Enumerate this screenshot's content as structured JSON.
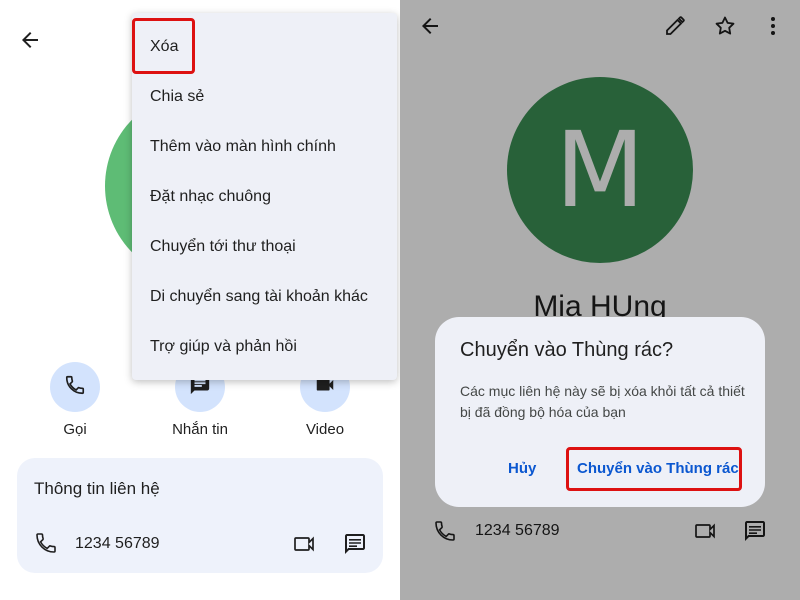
{
  "left": {
    "menu": {
      "items": [
        "Xóa",
        "Chia sẻ",
        "Thêm vào màn hình chính",
        "Đặt nhạc chuông",
        "Chuyển tới thư thoại",
        "Di chuyển sang tài khoản khác",
        "Trợ giúp và phản hồi"
      ]
    },
    "actions": {
      "call": "Gọi",
      "message": "Nhắn tin",
      "video": "Video"
    },
    "contact_info": {
      "title": "Thông tin liên hệ",
      "phone": "1234 56789"
    }
  },
  "right": {
    "avatar_letter": "M",
    "name": "Mia HUng",
    "dialog": {
      "title": "Chuyển vào Thùng rác?",
      "body": "Các mục liên hệ này sẽ bị xóa khỏi tất cả thiết bị đã đồng bộ hóa của bạn",
      "cancel": "Hủy",
      "confirm": "Chuyển vào Thùng rác"
    },
    "phone": "1234 56789"
  },
  "colors": {
    "highlight": "#dd1111",
    "avatar_left": "#5ebc75",
    "avatar_right": "#3c8f55",
    "accent": "#0b57d0"
  }
}
